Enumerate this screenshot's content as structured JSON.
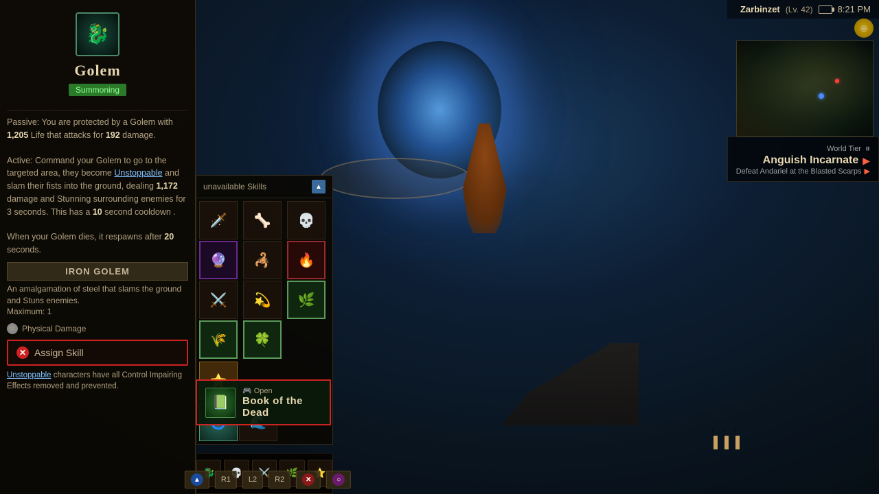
{
  "game": {
    "background": "dungeon"
  },
  "player": {
    "name": "Zarbinzet",
    "level": "Lv. 42",
    "time": "8:21 PM"
  },
  "world_tier": {
    "label": "World Tier",
    "name": "Anguish Incarnate",
    "quest": "Defeat Andariel at the Blasted Scarps",
    "pause_symbol": "⏸"
  },
  "skill_panel": {
    "icon": "🐉",
    "title": "Golem",
    "tag": "Summoning",
    "passive_desc_1": "Passive: You are protected by a Golem with ",
    "passive_life": "1,205",
    "passive_desc_2": " Life that attacks for ",
    "passive_damage": "192",
    "passive_desc_3": " damage.",
    "active_desc_1": "Active: Command your Golem to go to the targeted area, they become ",
    "active_link": "Unstoppable",
    "active_desc_2": " and slam their fists into the ground, dealing ",
    "active_damage": "1,172",
    "active_desc_3": " damage and Stunning surrounding enemies for 3 seconds.  This has a ",
    "active_cooldown": "10",
    "active_desc_4": " second cooldown .",
    "respawn_desc": "When your Golem dies, it respawns after ",
    "respawn_time": "20",
    "respawn_desc_2": " seconds.",
    "golem_type": "IRON GOLEM",
    "golem_type_desc": "An amalgamation of steel that slams the ground and Stuns enemies.",
    "maximum": "Maximum: 1",
    "damage_type": "Physical Damage",
    "assign_skill_label": "Assign Skill",
    "unstoppable_note_link": "Unstoppable",
    "unstoppable_note": " characters have all Control Impairing Effects removed and prevented."
  },
  "skills_panel": {
    "unavailable_label": "unavailable Skills",
    "triangle_symbol": "▲"
  },
  "book_button": {
    "icon": "📗",
    "open_label": "🎮 Open",
    "book_label": "Book of the Dead"
  },
  "bottom_controls": {
    "buttons": [
      {
        "symbol": "▲",
        "color": "blue",
        "label": ""
      },
      {
        "symbol": "R1",
        "color": "gray",
        "label": "R1"
      },
      {
        "symbol": "L2",
        "color": "gray",
        "label": "L2"
      },
      {
        "symbol": "R2",
        "color": "gray",
        "label": "R2"
      },
      {
        "symbol": "✕",
        "color": "red",
        "label": ""
      },
      {
        "symbol": "○",
        "color": "pink",
        "label": ""
      }
    ]
  }
}
